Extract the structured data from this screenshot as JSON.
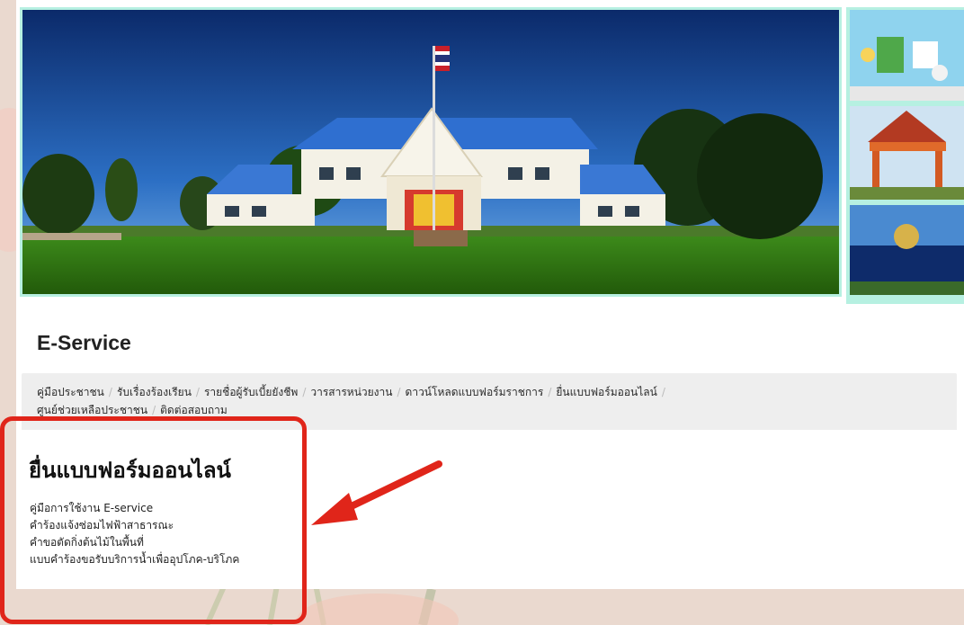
{
  "page": {
    "title": "E-Service"
  },
  "breadcrumb": {
    "items": [
      "คู่มือประชาชน",
      "รับเรื่องร้องเรียน",
      "รายชื่อผู้รับเบี้ยยังชีพ",
      "วารสารหน่วยงาน",
      "ดาวน์โหลดแบบฟอร์มราชการ",
      "ยื่นแบบฟอร์มออนไลน์",
      "ศูนย์ช่วยเหลือประชาชน",
      "ติดต่อสอบถาม"
    ],
    "separator": "/"
  },
  "section": {
    "title": "ยื่นแบบฟอร์มออนไลน์",
    "links": [
      "คู่มือการใช้งาน E-service",
      "คำร้องแจ้งซ่อมไฟฟ้าสาธารณะ",
      "คำขอตัดกิ่งต้นไม้ในพื้นที่",
      "แบบคำร้องขอรับบริการน้ำเพื่ออุปโภค-บริโภค"
    ]
  },
  "colors": {
    "highlight": "#e0251a",
    "arrow": "#e0251a",
    "banner_border": "#b6f0e1",
    "page_background": "#ead9cf"
  }
}
